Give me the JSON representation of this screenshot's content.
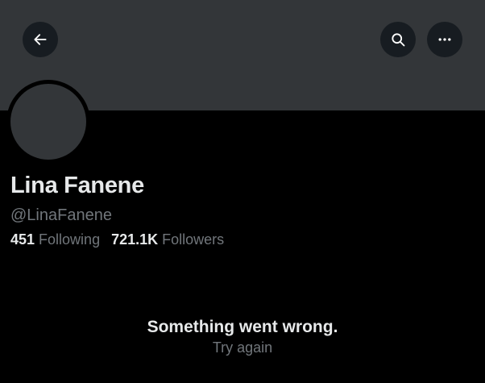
{
  "header": {
    "back_icon": "arrow-left-icon",
    "search_icon": "search-icon",
    "more_icon": "more-horizontal-icon"
  },
  "profile": {
    "name": "Lina Fanene",
    "handle": "@LinaFanene",
    "following_count": "451",
    "following_label": "Following",
    "followers_count": "721.1K",
    "followers_label": "Followers"
  },
  "error": {
    "title": "Something went wrong.",
    "retry_label": "Try again"
  },
  "colors": {
    "background": "#000000",
    "banner": "#333639",
    "primary_text": "#e7e9ea",
    "secondary_text": "#71767b"
  }
}
